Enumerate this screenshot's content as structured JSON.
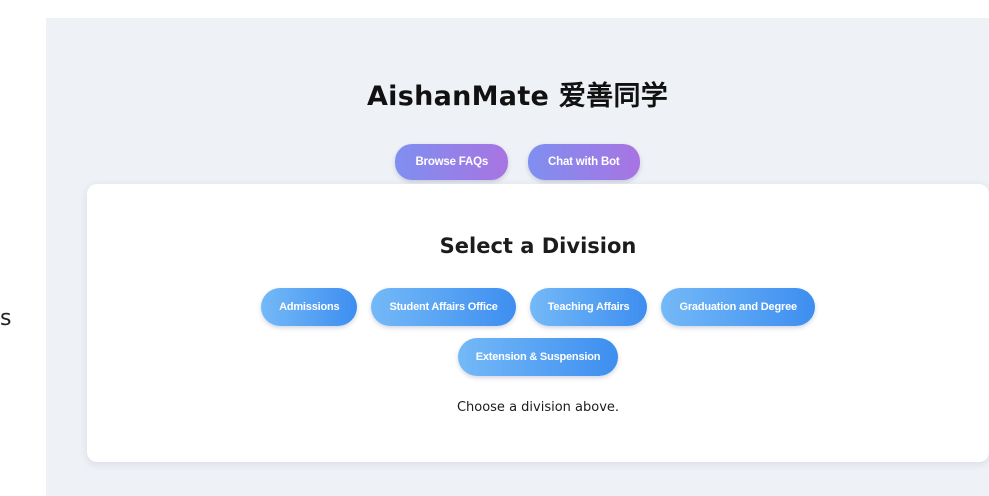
{
  "side_fragment": "s",
  "app": {
    "title": "AishanMate 爱善同学"
  },
  "top_actions": {
    "browse_faqs": "Browse FAQs",
    "chat_with_bot": "Chat with Bot"
  },
  "division_card": {
    "title": "Select a Division",
    "divisions": [
      "Admissions",
      "Student Affairs Office",
      "Teaching Affairs",
      "Graduation and Degree",
      "Extension & Suspension"
    ],
    "hint": "Choose a division above."
  },
  "colors": {
    "panel_background": "#eef1f6",
    "card_background": "#ffffff",
    "purple_gradient_start": "#7f8ff0",
    "purple_gradient_end": "#a874e2",
    "blue_gradient_start": "#74b9f7",
    "blue_gradient_end": "#3d8ef0"
  }
}
